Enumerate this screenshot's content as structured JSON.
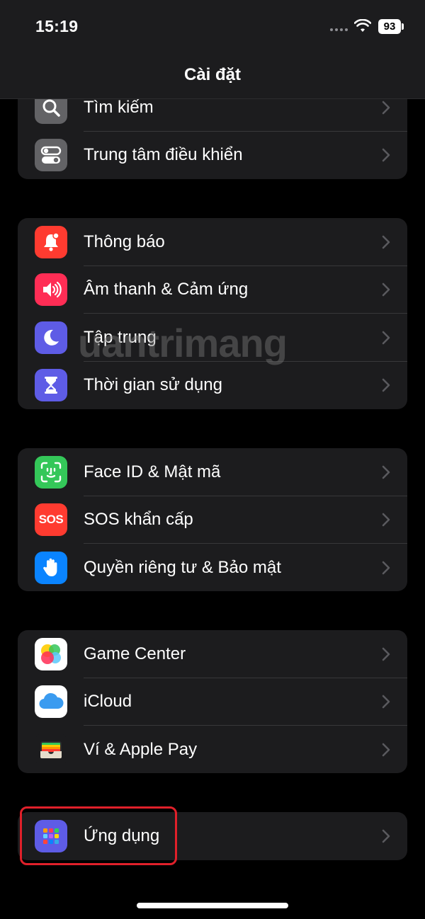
{
  "status_bar": {
    "time": "15:19",
    "battery": "93"
  },
  "nav": {
    "title": "Cài đặt"
  },
  "groups": [
    {
      "items": [
        {
          "label": "Tìm kiếm",
          "icon": "search-icon",
          "color": "#636366"
        },
        {
          "label": "Trung tâm điều khiển",
          "icon": "toggles-icon",
          "color": "#636366"
        }
      ]
    },
    {
      "items": [
        {
          "label": "Thông báo",
          "icon": "bell-icon",
          "color": "#ff3b30"
        },
        {
          "label": "Âm thanh & Cảm ứng",
          "icon": "speaker-icon",
          "color": "#ff2d55"
        },
        {
          "label": "Tập trung",
          "icon": "moon-icon",
          "color": "#5e5ce6"
        },
        {
          "label": "Thời gian sử dụng",
          "icon": "hourglass-icon",
          "color": "#5e5ce6"
        }
      ]
    },
    {
      "items": [
        {
          "label": "Face ID & Mật mã",
          "icon": "face-id-icon",
          "color": "#34c759"
        },
        {
          "label": "SOS khẩn cấp",
          "icon": "sos-icon",
          "color": "#ff3b30",
          "icon_text": "SOS"
        },
        {
          "label": "Quyền riêng tư & Bảo mật",
          "icon": "hand-icon",
          "color": "#0a84ff"
        }
      ]
    },
    {
      "items": [
        {
          "label": "Game Center",
          "icon": "game-center-icon",
          "color": "#ffffff"
        },
        {
          "label": "iCloud",
          "icon": "cloud-icon",
          "color": "#ffffff"
        },
        {
          "label": "Ví & Apple Pay",
          "icon": "wallet-icon",
          "color": "#1c1c1e"
        }
      ]
    },
    {
      "items": [
        {
          "label": "Ứng dụng",
          "icon": "apps-grid-icon",
          "color": "#5e5ce6"
        }
      ]
    }
  ],
  "watermark": "uantrimang",
  "highlight_color": "#e0202a"
}
